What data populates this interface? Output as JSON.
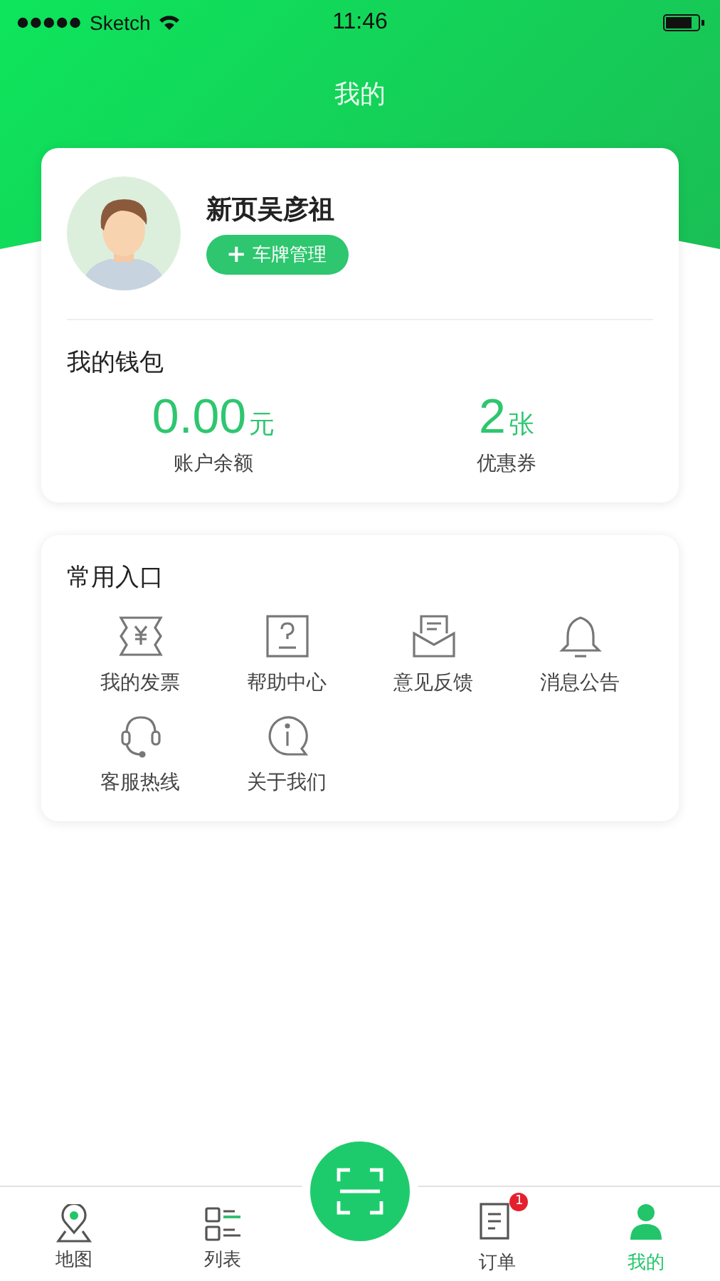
{
  "status_bar": {
    "carrier": "Sketch",
    "time": "11:46"
  },
  "header": {
    "title": "我的"
  },
  "profile": {
    "name": "新页吴彦祖",
    "plate_button": "车牌管理",
    "plate_icon": "+"
  },
  "wallet": {
    "title": "我的钱包",
    "items": [
      {
        "amount": "0.00",
        "unit": "元",
        "label": "账户余额"
      },
      {
        "amount": "2",
        "unit": "张",
        "label": "优惠券"
      }
    ]
  },
  "shortcuts": {
    "title": "常用入口",
    "items": [
      {
        "label": "我的发票"
      },
      {
        "label": "帮助中心"
      },
      {
        "label": "意见反馈"
      },
      {
        "label": "消息公告"
      },
      {
        "label": "客服热线"
      },
      {
        "label": "关于我们"
      }
    ]
  },
  "tab_bar": {
    "items": [
      {
        "label": "地图",
        "selected": false
      },
      {
        "label": "列表",
        "selected": false
      },
      {
        "label": "订单",
        "selected": false,
        "badge": "1"
      },
      {
        "label": "我的",
        "selected": true
      }
    ]
  }
}
